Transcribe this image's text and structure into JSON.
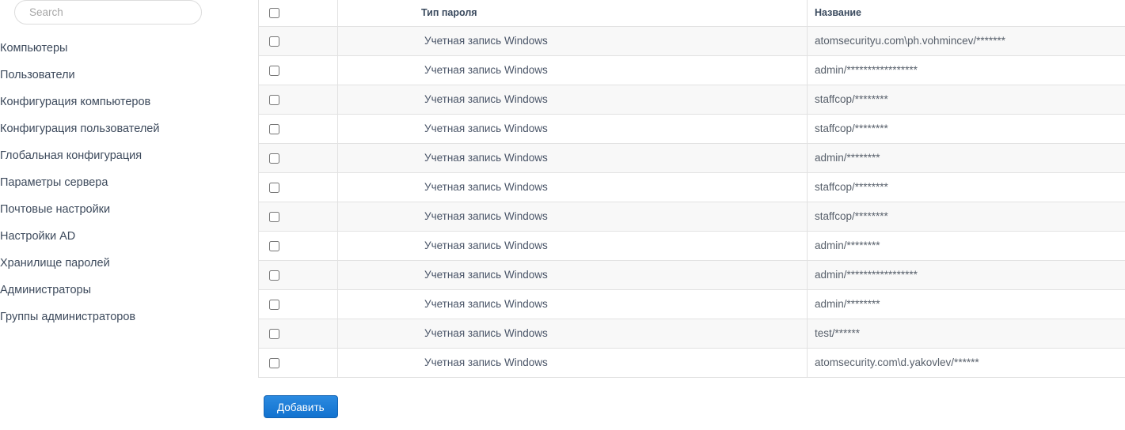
{
  "search": {
    "placeholder": "Search",
    "value": ""
  },
  "sidebar": {
    "items": [
      {
        "label": "Компьютеры"
      },
      {
        "label": "Пользователи"
      },
      {
        "label": "Конфигурация компьютеров"
      },
      {
        "label": "Конфигурация пользователей"
      },
      {
        "label": "Глобальная конфигурация"
      },
      {
        "label": "Параметры сервера"
      },
      {
        "label": "Почтовые настройки"
      },
      {
        "label": "Настройки AD"
      },
      {
        "label": "Хранилище паролей"
      },
      {
        "label": "Администраторы"
      },
      {
        "label": "Группы администраторов"
      }
    ]
  },
  "table": {
    "columns": {
      "select_all": "",
      "type": "Тип пароля",
      "name": "Название"
    },
    "rows": [
      {
        "type": "Учетная запись Windows",
        "name": "atomsecurityu.com\\ph.vohmincev/*******"
      },
      {
        "type": "Учетная запись Windows",
        "name": "admin/*****************"
      },
      {
        "type": "Учетная запись Windows",
        "name": "staffcop/********"
      },
      {
        "type": "Учетная запись Windows",
        "name": "staffcop/********"
      },
      {
        "type": "Учетная запись Windows",
        "name": "admin/********"
      },
      {
        "type": "Учетная запись Windows",
        "name": "staffcop/********"
      },
      {
        "type": "Учетная запись Windows",
        "name": "staffcop/********"
      },
      {
        "type": "Учетная запись Windows",
        "name": "admin/********"
      },
      {
        "type": "Учетная запись Windows",
        "name": "admin/*****************"
      },
      {
        "type": "Учетная запись Windows",
        "name": "admin/********"
      },
      {
        "type": "Учетная запись Windows",
        "name": "test/******"
      },
      {
        "type": "Учетная запись Windows",
        "name": "atomsecurity.com\\d.yakovlev/******"
      }
    ]
  },
  "actions": {
    "add_label": "Добавить"
  },
  "colors": {
    "accent": "#1272cf",
    "text": "#4a5568",
    "sidebar_text": "#3d4a5c",
    "row_stripe": "#f8f8f8",
    "border": "#e2e2e2"
  }
}
